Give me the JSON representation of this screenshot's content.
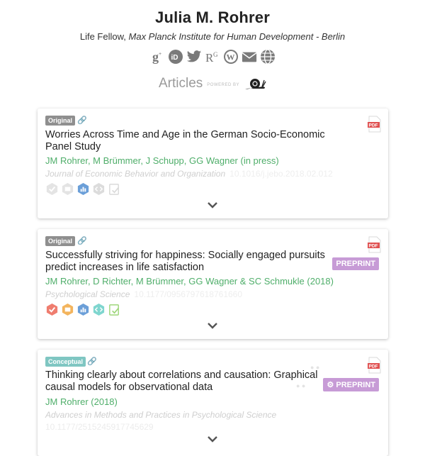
{
  "profile": {
    "name": "Julia M. Rohrer",
    "role": "Life Fellow,",
    "institution": "Max Planck Institute for Human Development - Berlin"
  },
  "social_icons": [
    "google-scholar-icon",
    "orcid-icon",
    "twitter-icon",
    "researchgate-icon",
    "wordpress-icon",
    "email-icon",
    "website-icon"
  ],
  "section": {
    "title": "Articles",
    "powered_by": "POWERED BY"
  },
  "articles": [
    {
      "type": "Original",
      "title": "Worries Across Time and Age in the German Socio-Economic Panel Study",
      "authors": "JM Rohrer, M Brümmer, J Schupp, GG Wagner (in press)",
      "journal": "Journal of Economic Behavior and Organization",
      "doi": "10.1016/j.jebo.2018.02.012"
    },
    {
      "type": "Original",
      "title": "Successfully striving for happiness: Socially engaged pursuits predict increases in life satisfaction",
      "authors": "JM Rohrer, D Richter, M Brümmer, GG Wagner & SC Schmukle (2018)",
      "journal": "Psychological Science",
      "doi": "10.1177/0956797618761660",
      "preprint": "PREPRINT"
    },
    {
      "type": "Conceptual",
      "title": "Thinking clearly about correlations and causation: Graphical causal models for observational data",
      "authors": "JM Rohrer (2018)",
      "journal": "Advances in Methods and Practices in Psychological Science",
      "doi": "10.1177/2515245917745629",
      "preprint": "PREPRINT"
    }
  ],
  "colors": {
    "authors": "#4fae6a",
    "preprint": "#c79bd6",
    "badge_original": "#8f8f8f",
    "badge_conceptual": "#7fc6c2",
    "pdf": "#e05050"
  }
}
